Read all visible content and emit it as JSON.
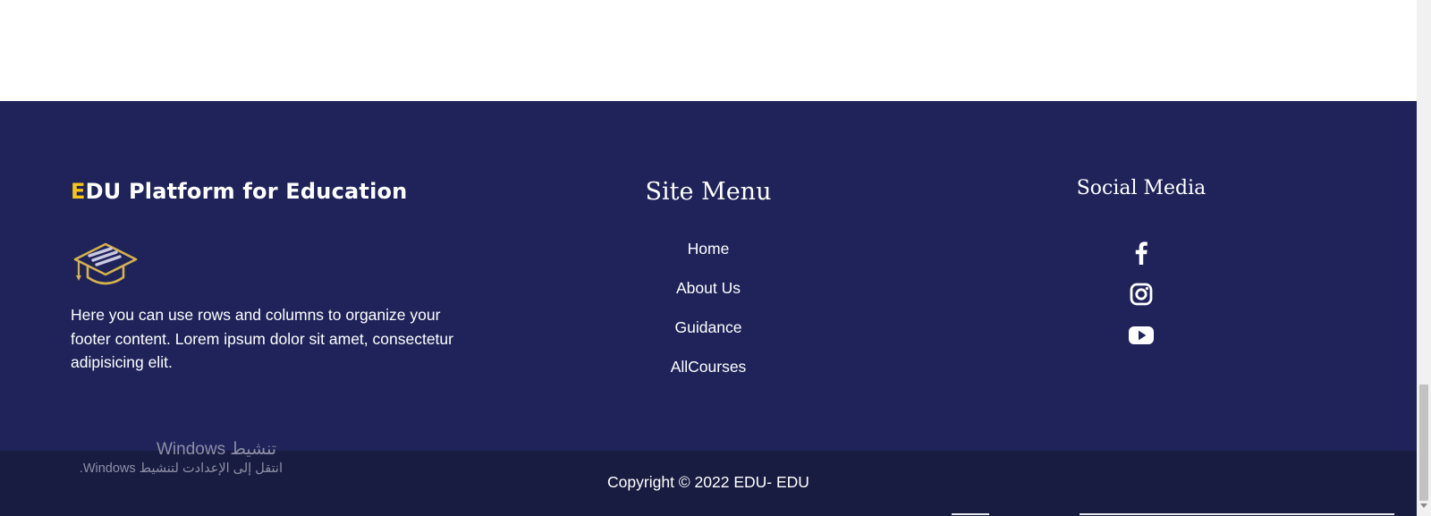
{
  "footer": {
    "brand_letter": "E",
    "brand_rest": "DU Platform for Education",
    "brand_icon": "graduation-cap-icon",
    "about_text": "Here you can use rows and columns to organize your footer content. Lorem ipsum dolor sit amet, consectetur adipisicing elit.",
    "site_menu": {
      "title": "Site Menu",
      "items": [
        {
          "label": "Home"
        },
        {
          "label": "About Us"
        },
        {
          "label": "Guidance"
        },
        {
          "label": "AllCourses"
        }
      ]
    },
    "social": {
      "title": "Social Media",
      "icons": [
        "facebook-icon",
        "instagram-icon",
        "youtube-icon"
      ]
    }
  },
  "bottom_bar": {
    "copyright": "Copyright © 2022 EDU- EDU"
  },
  "windows_activation": {
    "title": "تنشيط Windows",
    "subtitle": "انتقل إلى الإعدادت لتنشيط Windows."
  },
  "colors": {
    "footer_bg": "#1f2359",
    "bottom_bar_bg": "#191c41",
    "accent": "#f5c518",
    "text": "#ffffff"
  }
}
